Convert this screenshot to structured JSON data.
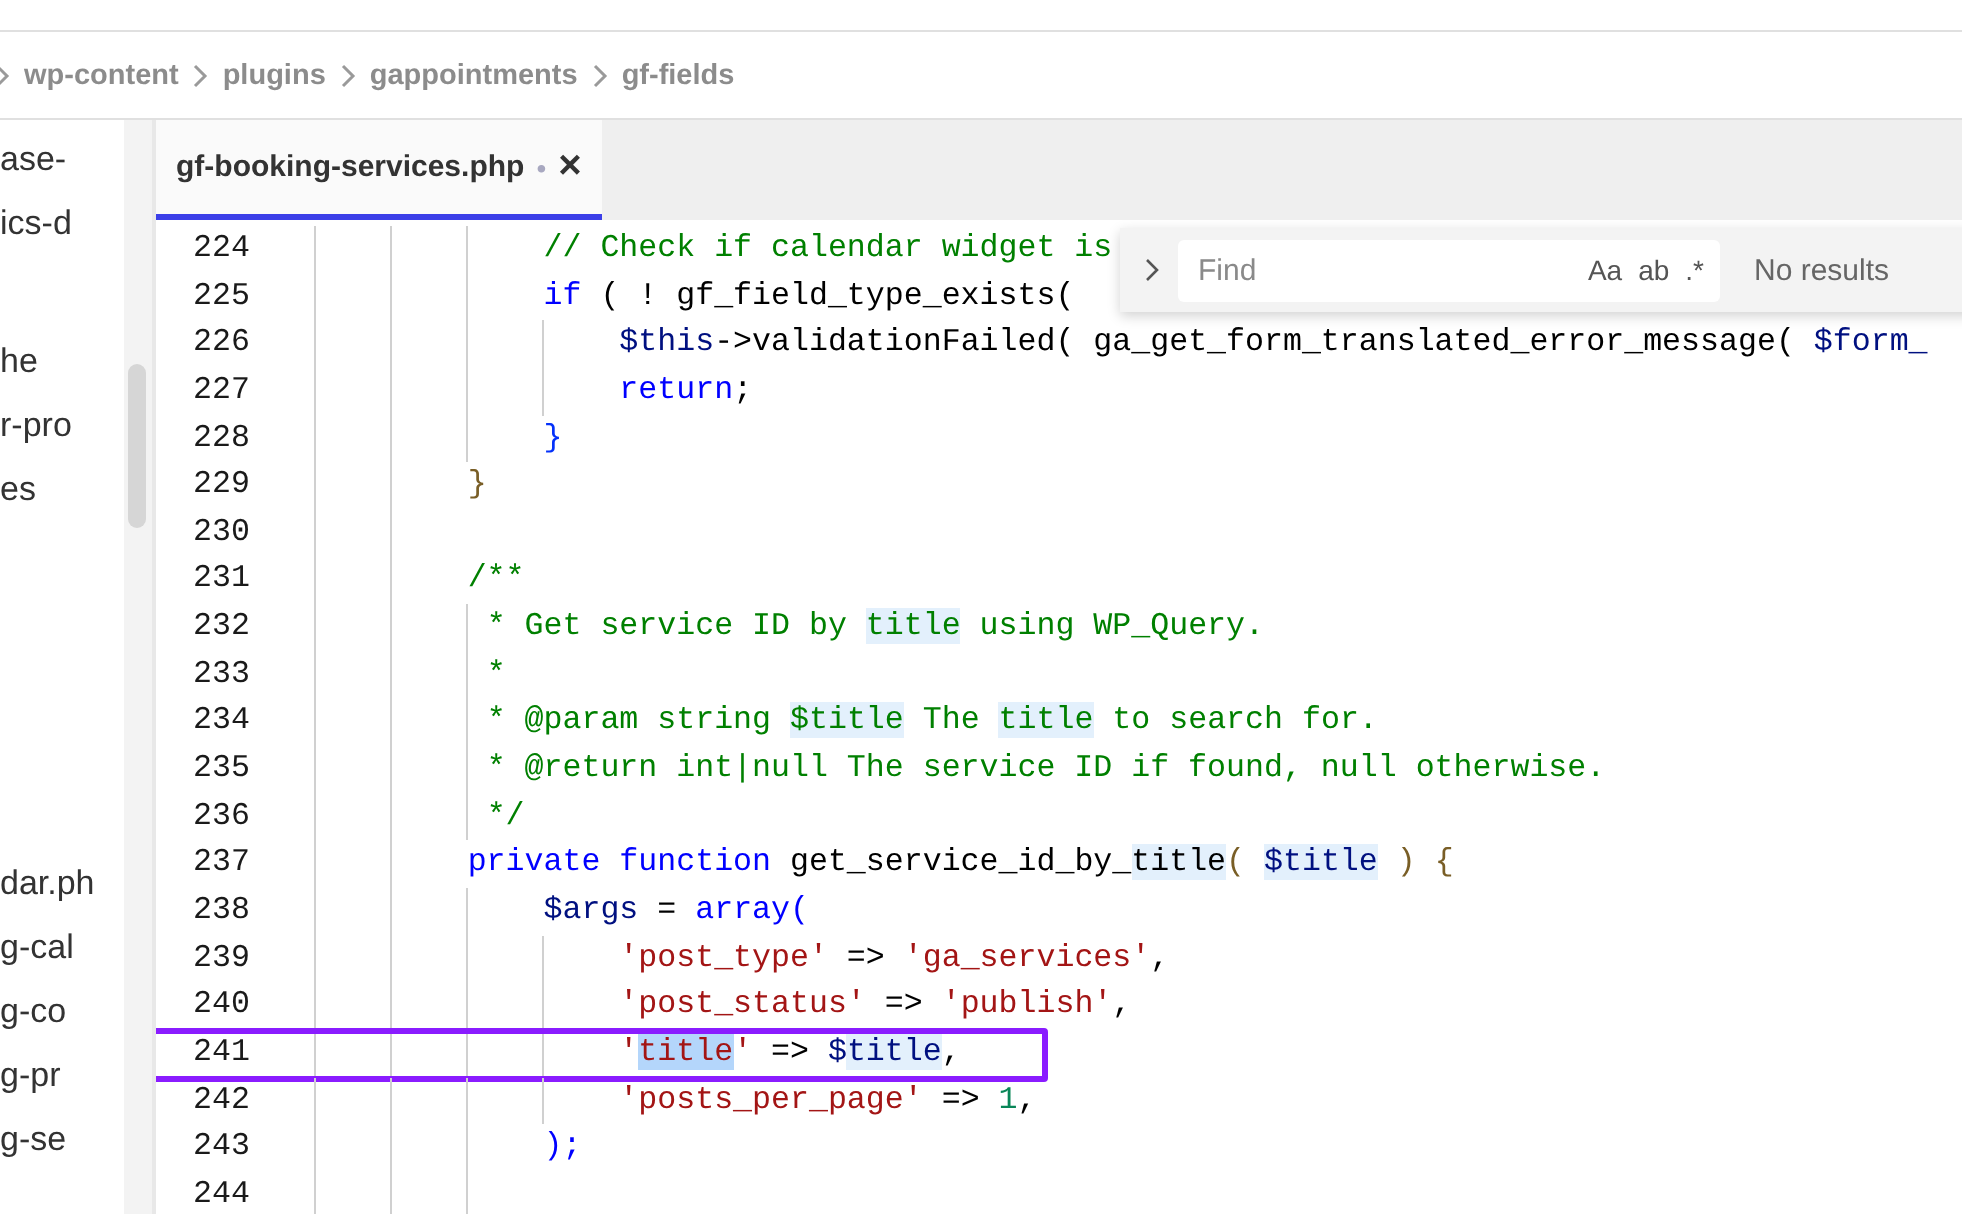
{
  "breadcrumbs": [
    "wp-content",
    "plugins",
    "gappointments",
    "gf-fields"
  ],
  "explorer": {
    "items": [
      {
        "label": "ase-"
      },
      {
        "label": "ics-d"
      },
      {
        "label": "he"
      },
      {
        "label": "r-pro"
      },
      {
        "label": "es"
      },
      {
        "label": "dar.ph"
      },
      {
        "label": "g-cal"
      },
      {
        "label": "g-co"
      },
      {
        "label": "g-pr"
      },
      {
        "label": "g-se"
      }
    ]
  },
  "tabs": [
    {
      "label": "gf-booking-services.php",
      "selected": true,
      "modified_mark": "•",
      "close": "×"
    }
  ],
  "find_widget": {
    "placeholder": "Find",
    "toggles": [
      "Aa",
      "ab",
      ".*"
    ],
    "result": "No results"
  },
  "editor": {
    "lines": [
      {
        "number": "224",
        "boxed": false,
        "tokens": [
          {
            "text": "        // Check if calendar widget is",
            "kind": "comment",
            "highlighted": false,
            "selected": false
          }
        ]
      },
      {
        "number": "225",
        "boxed": false,
        "tokens": [
          {
            "text": "        if",
            "kind": "keyword",
            "highlighted": false,
            "selected": false
          },
          {
            "text": " ( ! gf_field_type_exists( ",
            "kind": "plain",
            "highlighted": false,
            "selected": false
          }
        ]
      },
      {
        "number": "226",
        "boxed": false,
        "tokens": [
          {
            "text": "            $this",
            "kind": "variable",
            "highlighted": false,
            "selected": false
          },
          {
            "text": "->validationFailed( ga_get_form_translated_error_message( ",
            "kind": "plain",
            "highlighted": false,
            "selected": false
          },
          {
            "text": "$form_",
            "kind": "variable",
            "highlighted": false,
            "selected": false
          }
        ]
      },
      {
        "number": "227",
        "boxed": false,
        "tokens": [
          {
            "text": "            return",
            "kind": "keyword",
            "highlighted": false,
            "selected": false
          },
          {
            "text": ";",
            "kind": "plain",
            "highlighted": false,
            "selected": false
          }
        ]
      },
      {
        "number": "228",
        "boxed": false,
        "tokens": [
          {
            "text": "        }",
            "kind": "bracket2",
            "highlighted": false,
            "selected": false
          }
        ]
      },
      {
        "number": "229",
        "boxed": false,
        "tokens": [
          {
            "text": "    }",
            "kind": "bracket1",
            "highlighted": false,
            "selected": false
          }
        ]
      },
      {
        "number": "230",
        "boxed": false
      },
      {
        "number": "231",
        "boxed": false,
        "tokens": [
          {
            "text": "    /**",
            "kind": "comment",
            "highlighted": false,
            "selected": false
          }
        ]
      },
      {
        "number": "232",
        "boxed": false,
        "tokens": [
          {
            "text": "     * Get service ID by ",
            "kind": "comment",
            "highlighted": false,
            "selected": false
          },
          {
            "text": "title",
            "kind": "comment",
            "highlighted": true,
            "selected": false
          },
          {
            "text": " using WP_Query.",
            "kind": "comment",
            "highlighted": false,
            "selected": false
          }
        ]
      },
      {
        "number": "233",
        "boxed": false,
        "tokens": [
          {
            "text": "     *",
            "kind": "comment",
            "highlighted": false,
            "selected": false
          }
        ]
      },
      {
        "number": "234",
        "boxed": false,
        "tokens": [
          {
            "text": "     * @param string ",
            "kind": "comment",
            "highlighted": false,
            "selected": false
          },
          {
            "text": "$title",
            "kind": "comment",
            "highlighted": true,
            "selected": false
          },
          {
            "text": " The ",
            "kind": "comment",
            "highlighted": false,
            "selected": false
          },
          {
            "text": "title",
            "kind": "comment",
            "highlighted": true,
            "selected": false
          },
          {
            "text": " to search for.",
            "kind": "comment",
            "highlighted": false,
            "selected": false
          }
        ]
      },
      {
        "number": "235",
        "boxed": false,
        "tokens": [
          {
            "text": "     * @return int|null The service ID if found, null otherwise.",
            "kind": "comment",
            "highlighted": false,
            "selected": false
          }
        ]
      },
      {
        "number": "236",
        "boxed": false,
        "tokens": [
          {
            "text": "     */",
            "kind": "comment",
            "highlighted": false,
            "selected": false
          }
        ]
      },
      {
        "number": "237",
        "boxed": false,
        "tokens": [
          {
            "text": "    private function",
            "kind": "keyword",
            "highlighted": false,
            "selected": false
          },
          {
            "text": " get_service_id_by_",
            "kind": "plain",
            "highlighted": false,
            "selected": false
          },
          {
            "text": "title",
            "kind": "plain",
            "highlighted": true,
            "selected": false
          },
          {
            "text": "( ",
            "kind": "bracket1",
            "highlighted": false,
            "selected": false
          },
          {
            "text": "$title",
            "kind": "variable",
            "highlighted": true,
            "selected": false
          },
          {
            "text": " ) {",
            "kind": "bracket1",
            "highlighted": false,
            "selected": false
          }
        ]
      },
      {
        "number": "238",
        "boxed": false,
        "tokens": [
          {
            "text": "        $args",
            "kind": "variable",
            "highlighted": false,
            "selected": false
          },
          {
            "text": " = ",
            "kind": "plain",
            "highlighted": false,
            "selected": false
          },
          {
            "text": "array(",
            "kind": "keyword",
            "highlighted": false,
            "selected": false
          }
        ]
      },
      {
        "number": "239",
        "boxed": false,
        "tokens": [
          {
            "text": "            'post_type'",
            "kind": "string",
            "highlighted": false,
            "selected": false
          },
          {
            "text": " => ",
            "kind": "plain",
            "highlighted": false,
            "selected": false
          },
          {
            "text": "'ga_services'",
            "kind": "string",
            "highlighted": false,
            "selected": false
          },
          {
            "text": ",",
            "kind": "plain",
            "highlighted": false,
            "selected": false
          }
        ]
      },
      {
        "number": "240",
        "boxed": false,
        "tokens": [
          {
            "text": "            'post_status'",
            "kind": "string",
            "highlighted": false,
            "selected": false
          },
          {
            "text": " => ",
            "kind": "plain",
            "highlighted": false,
            "selected": false
          },
          {
            "text": "'publish'",
            "kind": "string",
            "highlighted": false,
            "selected": false
          },
          {
            "text": ",",
            "kind": "plain",
            "highlighted": false,
            "selected": false
          }
        ]
      },
      {
        "number": "241",
        "boxed": true,
        "tokens": [
          {
            "text": "            '",
            "kind": "string",
            "highlighted": false,
            "selected": false
          },
          {
            "text": "title",
            "kind": "string",
            "highlighted": false,
            "selected": true
          },
          {
            "text": "'",
            "kind": "string",
            "highlighted": false,
            "selected": false
          },
          {
            "text": " => ",
            "kind": "plain",
            "highlighted": false,
            "selected": false
          },
          {
            "text": "$",
            "kind": "variable",
            "highlighted": false,
            "selected": false
          },
          {
            "text": "title",
            "kind": "variable",
            "highlighted": true,
            "selected": false
          },
          {
            "text": ",",
            "kind": "plain",
            "highlighted": false,
            "selected": false
          }
        ]
      },
      {
        "number": "242",
        "boxed": false,
        "tokens": [
          {
            "text": "            'posts_per_page'",
            "kind": "string",
            "highlighted": false,
            "selected": false
          },
          {
            "text": " => ",
            "kind": "plain",
            "highlighted": false,
            "selected": false
          },
          {
            "text": "1",
            "kind": "number",
            "highlighted": false,
            "selected": false
          },
          {
            "text": ",",
            "kind": "plain",
            "highlighted": false,
            "selected": false
          }
        ]
      },
      {
        "number": "243",
        "boxed": false,
        "tokens": [
          {
            "text": "        );",
            "kind": "keyword",
            "highlighted": false,
            "selected": false
          }
        ]
      },
      {
        "number": "244",
        "boxed": false
      }
    ]
  }
}
